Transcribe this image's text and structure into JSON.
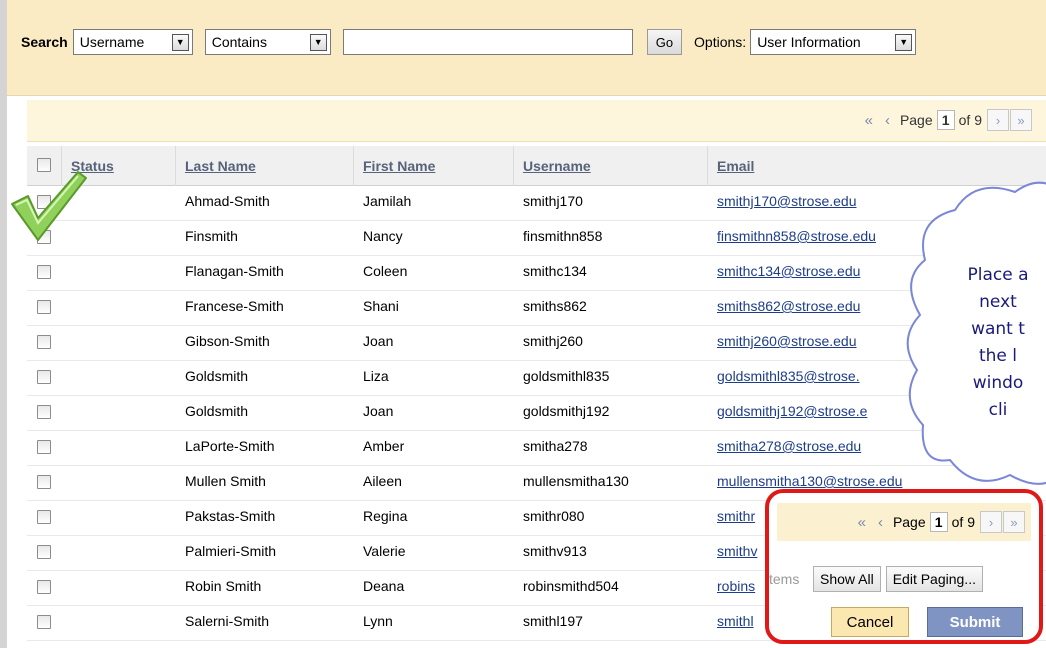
{
  "search": {
    "label": "Search",
    "field": "Username",
    "operator": "Contains",
    "query_value": "",
    "go_label": "Go",
    "options_label": "Options:",
    "options_value": "User Information"
  },
  "pager": {
    "page_label": "Page",
    "current": "1",
    "of_label": "of 9",
    "first_icon": "«",
    "prev_icon": "‹",
    "next_icon": "›",
    "last_icon": "»"
  },
  "table": {
    "headers": [
      "Status",
      "Last Name",
      "First Name",
      "Username",
      "Email"
    ],
    "rows": [
      {
        "last": "Ahmad-Smith",
        "first": "Jamilah",
        "user": "smithj170",
        "email": "smithj170@strose.edu"
      },
      {
        "last": "Finsmith",
        "first": "Nancy",
        "user": "finsmithn858",
        "email": "finsmithn858@strose.edu"
      },
      {
        "last": "Flanagan-Smith",
        "first": "Coleen",
        "user": "smithc134",
        "email": "smithc134@strose.edu"
      },
      {
        "last": "Francese-Smith",
        "first": "Shani",
        "user": "smiths862",
        "email": "smiths862@strose.edu"
      },
      {
        "last": "Gibson-Smith",
        "first": "Joan",
        "user": "smithj260",
        "email": "smithj260@strose.edu"
      },
      {
        "last": "Goldsmith",
        "first": "Liza",
        "user": "goldsmithl835",
        "email": "goldsmithl835@strose."
      },
      {
        "last": "Goldsmith",
        "first": "Joan",
        "user": "goldsmithj192",
        "email": "goldsmithj192@strose.e"
      },
      {
        "last": "LaPorte-Smith",
        "first": "Amber",
        "user": "smitha278",
        "email": "smitha278@strose.edu"
      },
      {
        "last": "Mullen Smith",
        "first": "Aileen",
        "user": "mullensmitha130",
        "email": "mullensmitha130@strose.edu"
      },
      {
        "last": "Pakstas-Smith",
        "first": "Regina",
        "user": "smithr080",
        "email": "smithr"
      },
      {
        "last": "Palmieri-Smith",
        "first": "Valerie",
        "user": "smithv913",
        "email": "smithv"
      },
      {
        "last": "Robin Smith",
        "first": "Deana",
        "user": "robinsmithd504",
        "email": "robins"
      },
      {
        "last": "Salerni-Smith",
        "first": "Lynn",
        "user": "smithl197",
        "email": "smithl"
      }
    ]
  },
  "callout": {
    "lines": [
      "Place a",
      "next",
      "want t",
      "the l",
      "windo",
      "cli"
    ]
  },
  "popup": {
    "page_label": "Page",
    "current": "1",
    "of_label": "of 9",
    "items_label": "tems",
    "show_all_label": "Show All",
    "edit_paging_label": "Edit Paging...",
    "cancel_label": "Cancel",
    "submit_label": "Submit"
  },
  "colors": {
    "search_bg": "#faebc4",
    "header_link": "#56637a",
    "email_link": "#1d3d8a",
    "submit_bg": "#8094c4",
    "highlight_border": "#e01818",
    "checkmark": "#7ac943"
  }
}
